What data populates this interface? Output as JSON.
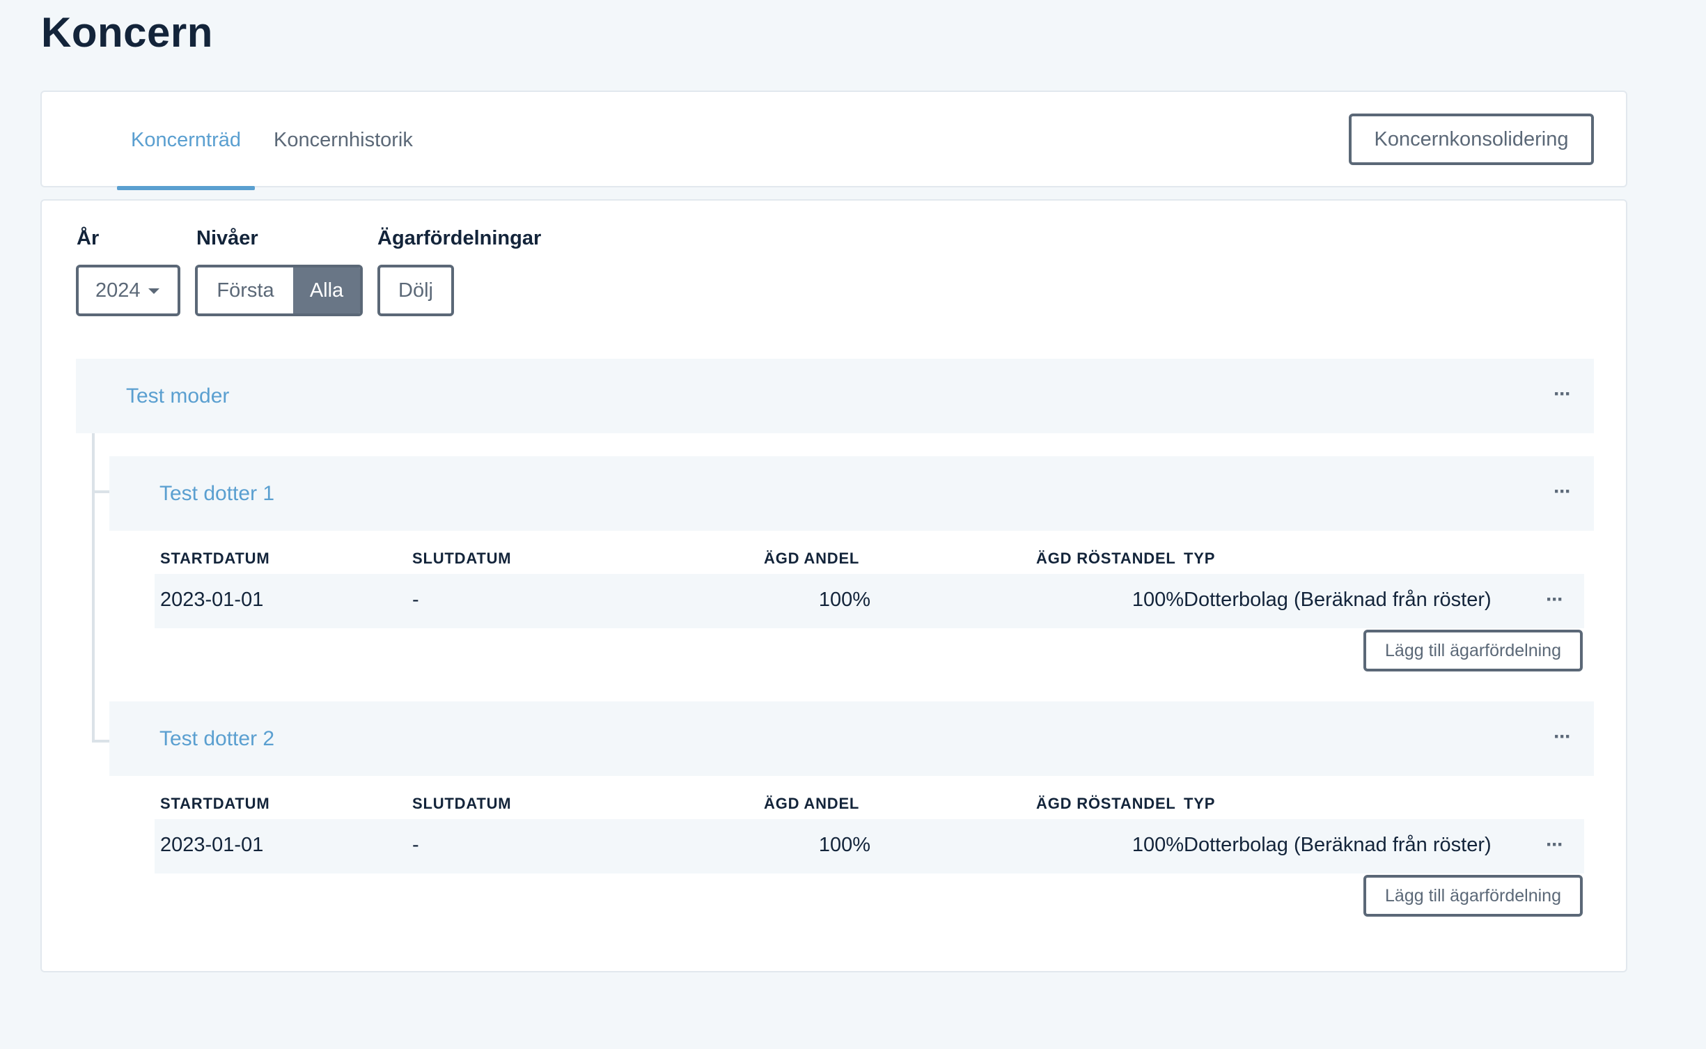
{
  "page": {
    "title": "Koncern"
  },
  "tabs": [
    {
      "label": "Koncernträd",
      "active": true
    },
    {
      "label": "Koncernhistorik",
      "active": false
    }
  ],
  "consolidation_button": "Koncernkonsolidering",
  "filters": {
    "year": {
      "label": "År",
      "value": "2024"
    },
    "levels": {
      "label": "Nivåer",
      "options": [
        "Första",
        "Alla"
      ],
      "selected": "Alla"
    },
    "ownership": {
      "label": "Ägarfördelningar",
      "button": "Dölj"
    }
  },
  "tree": {
    "parent": {
      "name": "Test moder"
    },
    "columns": {
      "start": "STARTDATUM",
      "end": "SLUTDATUM",
      "share": "ÄGD ANDEL",
      "vote": "ÄGD RÖSTANDEL",
      "type": "TYP"
    },
    "children": [
      {
        "name": "Test dotter 1",
        "rows": [
          {
            "start": "2023-01-01",
            "end": "-",
            "share": "100%",
            "vote": "100%",
            "type": "Dotterbolag (Beräknad från röster)"
          }
        ],
        "add_button": "Lägg till ägarfördelning"
      },
      {
        "name": "Test dotter 2",
        "rows": [
          {
            "start": "2023-01-01",
            "end": "-",
            "share": "100%",
            "vote": "100%",
            "type": "Dotterbolag (Beräknad från röster)"
          }
        ],
        "add_button": "Lägg till ägarfördelning"
      }
    ]
  },
  "menu_icon": "ellipsis-icon",
  "colors": {
    "accent": "#5a9fd0",
    "border_dark": "#5b6877",
    "row_bg": "#f3f7fa",
    "page_bg": "#f3f7fa"
  }
}
